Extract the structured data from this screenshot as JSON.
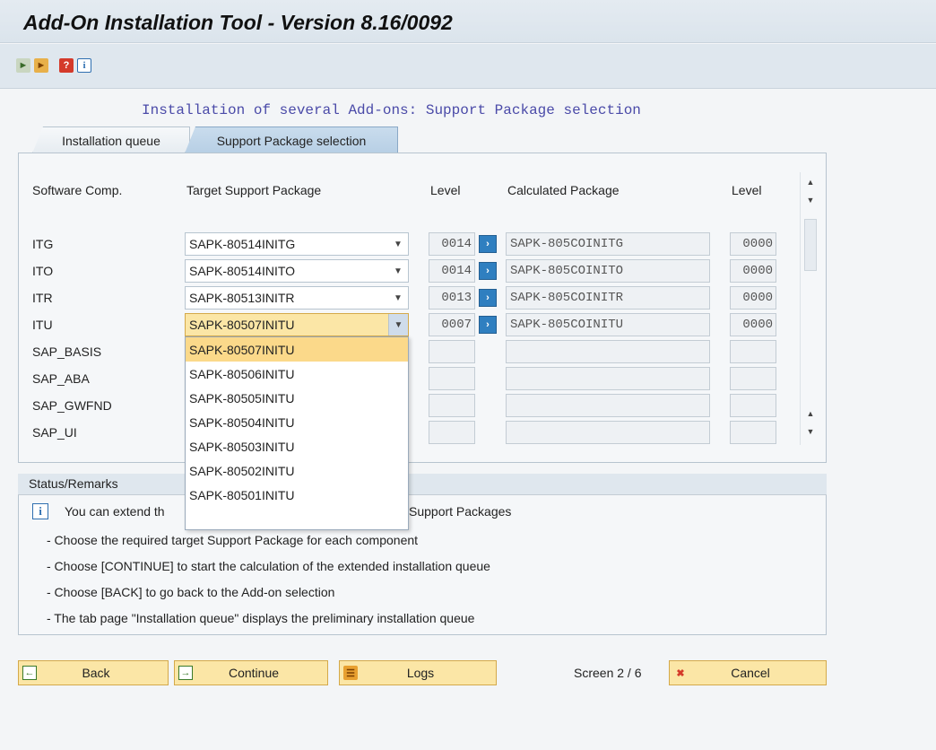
{
  "window": {
    "title": "Add-On Installation Tool - Version 8.16/0092"
  },
  "toolbar": {
    "icons": [
      "execute-icon",
      "execute-all-icon",
      "help-icon",
      "info-icon"
    ]
  },
  "page": {
    "heading": "Installation of several Add-ons: Support Package selection"
  },
  "tabs": [
    {
      "label": "Installation queue",
      "active": false
    },
    {
      "label": "Support Package selection",
      "active": true
    }
  ],
  "grid": {
    "headers": {
      "software_comp": "Software Comp.",
      "target_sp": "Target Support Package",
      "level": "Level",
      "calculated": "Calculated Package",
      "level2": "Level"
    },
    "rows": [
      {
        "comp": "ITG",
        "target": "SAPK-80514INITG",
        "level": "0014",
        "calculated": "SAPK-805COINITG",
        "level2": "0000"
      },
      {
        "comp": "ITO",
        "target": "SAPK-80514INITO",
        "level": "0014",
        "calculated": "SAPK-805COINITO",
        "level2": "0000"
      },
      {
        "comp": "ITR",
        "target": "SAPK-80513INITR",
        "level": "0013",
        "calculated": "SAPK-805COINITR",
        "level2": "0000"
      },
      {
        "comp": "ITU",
        "target": "SAPK-80507INITU",
        "level": "0007",
        "calculated": "SAPK-805COINITU",
        "level2": "0000"
      },
      {
        "comp": "SAP_BASIS",
        "target": "",
        "level": "",
        "calculated": "",
        "level2": ""
      },
      {
        "comp": "SAP_ABA",
        "target": "",
        "level": "",
        "calculated": "",
        "level2": ""
      },
      {
        "comp": "SAP_GWFND",
        "target": "",
        "level": "",
        "calculated": "",
        "level2": ""
      },
      {
        "comp": "SAP_UI",
        "target": "",
        "level": "",
        "calculated": "",
        "level2": ""
      }
    ]
  },
  "dropdown": {
    "selected": "SAPK-80507INITU",
    "options": [
      "SAPK-80507INITU",
      "SAPK-80506INITU",
      "SAPK-80505INITU",
      "SAPK-80504INITU",
      "SAPK-80503INITU",
      "SAPK-80502INITU",
      "SAPK-80501INITU"
    ]
  },
  "status": {
    "title": "Status/Remarks",
    "line_prefix": "You can extend th",
    "line_suffix": "Support Packages",
    "lines": [
      "- Choose the required target Support Package for each component",
      "- Choose [CONTINUE] to start the calculation of the extended installation queue",
      "- Choose [BACK] to go back to the Add-on selection",
      "- The tab page \"Installation queue\" displays the preliminary installation queue"
    ]
  },
  "footer": {
    "back": "Back",
    "continue": "Continue",
    "logs": "Logs",
    "screen": "Screen 2 / 6",
    "cancel": "Cancel"
  }
}
